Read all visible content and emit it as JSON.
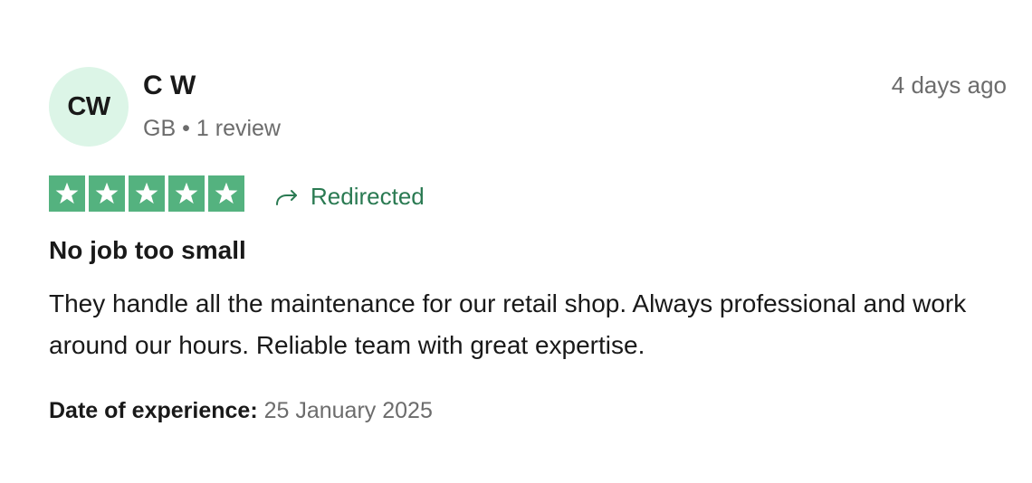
{
  "reviewer": {
    "initials": "CW",
    "name": "C W",
    "country": "GB",
    "separator": "•",
    "review_count": "1 review"
  },
  "posted": "4 days ago",
  "rating": {
    "value": 5,
    "max": 5,
    "star_color": "#54b27f"
  },
  "redirect": {
    "icon": "redirect-arrow-icon",
    "label": "Redirected",
    "color": "#2a7a52"
  },
  "review": {
    "title": "No job too small",
    "body": "They handle all the maintenance for our retail shop. Always professional and work around our hours. Reliable team with great expertise."
  },
  "experience": {
    "label": "Date of experience:",
    "date": "25 January 2025"
  },
  "colors": {
    "avatar_bg": "#dcf5e7",
    "muted_text": "#6c6c6c"
  }
}
